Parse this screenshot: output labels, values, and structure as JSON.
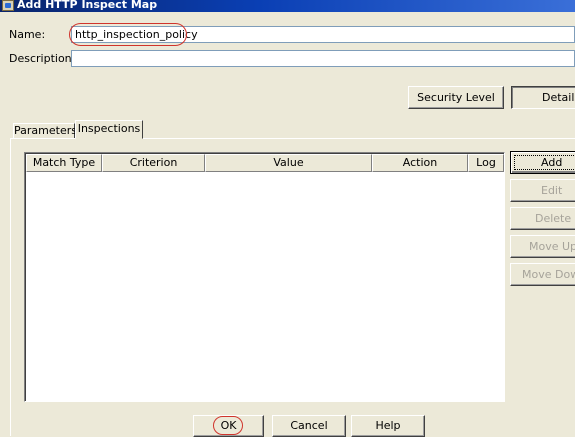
{
  "window": {
    "title": "Add HTTP  Inspect Map"
  },
  "form": {
    "name_label": "Name:",
    "name_value": "http_inspection_policy",
    "description_label": "Description:",
    "description_value": ""
  },
  "security_buttons": {
    "security_level": "Security Level",
    "details": "Details"
  },
  "tabs": [
    {
      "label": "Parameters",
      "active": false
    },
    {
      "label": "Inspections",
      "active": true
    }
  ],
  "table": {
    "columns": [
      "Match Type",
      "Criterion",
      "Value",
      "Action",
      "Log"
    ],
    "rows": []
  },
  "side_buttons": {
    "add": "Add",
    "edit": "Edit",
    "delete": "Delete",
    "move_up": "Move Up",
    "move_down": "Move Down"
  },
  "footer_buttons": {
    "ok": "OK",
    "cancel": "Cancel",
    "help": "Help"
  },
  "colors": {
    "highlight_oval": "#d0342c",
    "title_bar": "#0a246a"
  }
}
